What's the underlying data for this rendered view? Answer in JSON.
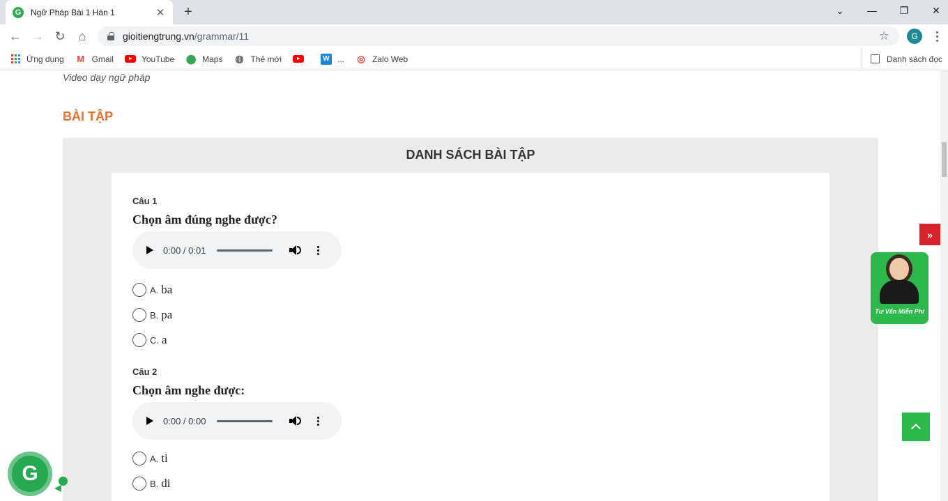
{
  "browser": {
    "tab_title": "Ngữ Pháp Bài 1 Hán 1",
    "url_host": "gioitiengtrung.vn",
    "url_path": "/grammar/11",
    "profile_initial": "G",
    "bookmarks": [
      {
        "label": "Ứng dụng",
        "icon": "apps-grid-icon"
      },
      {
        "label": "Gmail",
        "icon": "gmail-icon"
      },
      {
        "label": "YouTube",
        "icon": "youtube-icon"
      },
      {
        "label": "Maps",
        "icon": "maps-icon"
      },
      {
        "label": "Thẻ mới",
        "icon": "globe-icon"
      },
      {
        "label": "",
        "icon": "youtube-icon"
      },
      {
        "label": "...",
        "icon": "word-icon"
      },
      {
        "label": "Zalo Web",
        "icon": "zalo-icon"
      }
    ],
    "reading_list_label": "Danh sách đọc"
  },
  "page": {
    "video_caption": "Video dạy ngữ pháp",
    "section_title": "BÀI TẬP",
    "panel_title": "DANH SÁCH BÀI TẬP",
    "questions": [
      {
        "label": "Câu 1",
        "text": "Chọn âm đúng nghe được?",
        "player_time": "0:00 / 0:01",
        "options": [
          {
            "letter": "A.",
            "text": "ba"
          },
          {
            "letter": "B.",
            "text": "pa"
          },
          {
            "letter": "C.",
            "text": "a"
          }
        ]
      },
      {
        "label": "Câu 2",
        "text": "Chọn âm nghe được:",
        "player_time": "0:00 / 0:00",
        "options": [
          {
            "letter": "A.",
            "text": "ti"
          },
          {
            "letter": "B.",
            "text": "di"
          }
        ]
      }
    ],
    "advisor_label": "Tư Vấn Miễn Phí",
    "collapse_symbol": "»",
    "chat_bubble_letter": "G"
  },
  "colors": {
    "accent_orange": "#e8702a",
    "brand_green": "#2db84c",
    "collapse_red": "#d9232a"
  }
}
